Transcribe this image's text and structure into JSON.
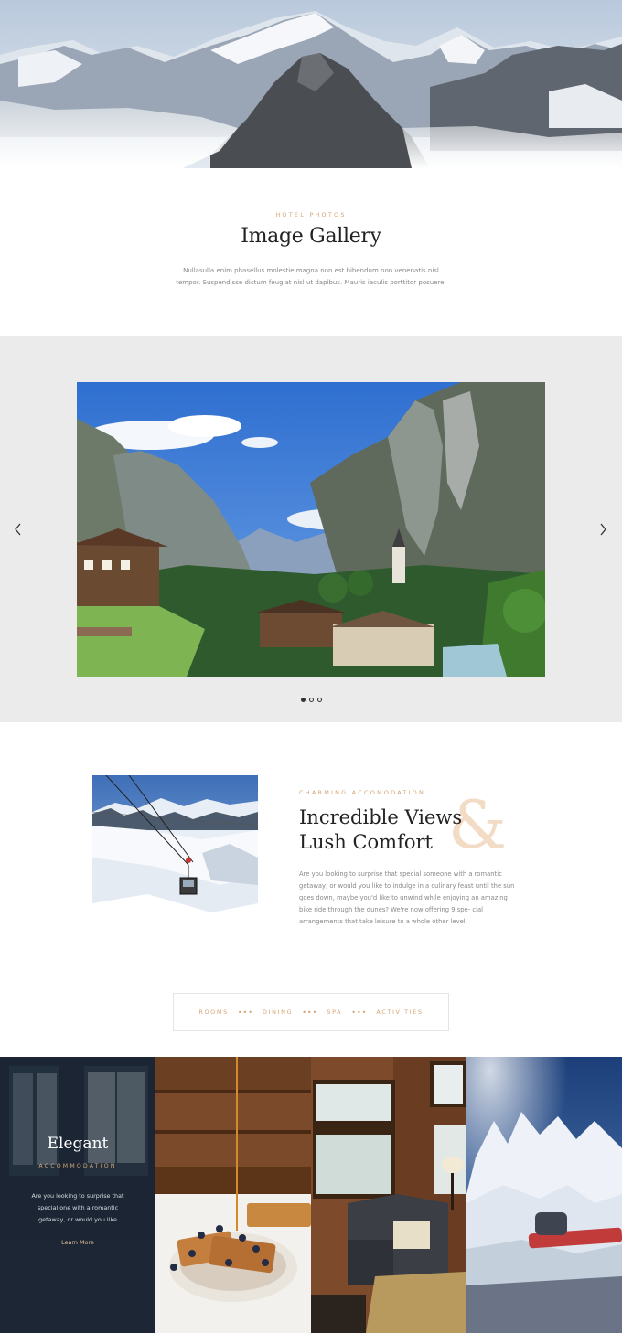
{
  "intro": {
    "eyebrow": "HOTEL PHOTOS",
    "title": "Image Gallery",
    "text_line1": "Nullasulla enim phasellus molestie magna non est bibendum non venenatis nisl",
    "text_line2": "tempor. Suspendisse dictum feugiat nisl ut dapibus. Mauris iaculis porttitor posuere."
  },
  "gallery": {
    "prev_icon": "chevron-left-icon",
    "next_icon": "chevron-right-icon",
    "dots": 3,
    "active_dot": 0
  },
  "feature": {
    "eyebrow": "CHARMING ACCOMODATION",
    "title_line1": "Incredible Views",
    "title_line2": "Lush Comfort",
    "ampersand": "&",
    "body_line1": "Are you looking to surprise that special someone with a romantic",
    "body_line2": "getaway, or would you like to indulge in a culinary feast until the sun",
    "body_line3": "goes down, maybe you'd like to unwind while enjoying an amazing",
    "body_line4": "bike ride through the dunes? We're now offering 9 spe- cial",
    "body_line5": "arrangements that take leisure to a whole other level."
  },
  "tabs": {
    "rooms": "ROOMS",
    "dining": "DINING",
    "spa": "SPA",
    "activities": "ACTIVITIES",
    "separator": "•••"
  },
  "card": {
    "title": "Elegant",
    "subtitle": "ACCOMMODATION",
    "line1": "Are you looking to surprise that",
    "line2": "special one with a romantic",
    "line3": "getaway, or would you like",
    "link": "Learn More"
  },
  "colors": {
    "accent": "#d4a574",
    "gallery_bg": "#ebebeb",
    "ampersand": "#f2dcc6"
  }
}
